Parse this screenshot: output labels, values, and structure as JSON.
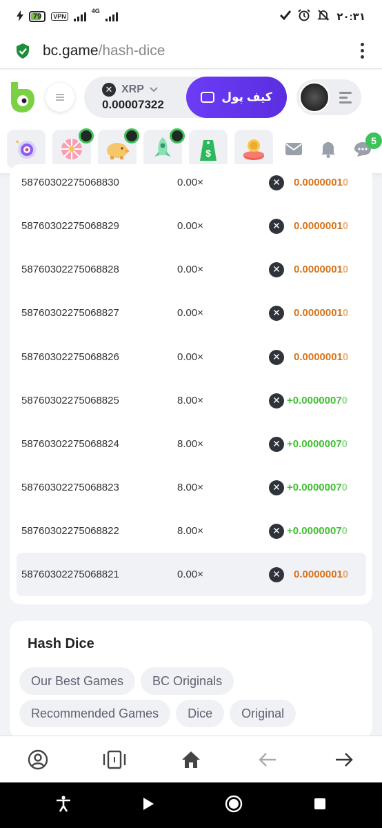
{
  "status_bar": {
    "battery": "79",
    "vpn": "VPN",
    "network": "4G",
    "time": "۲۰:۳۱"
  },
  "browser": {
    "domain": "bc.game",
    "path": "/hash-dice"
  },
  "header": {
    "currency": "XRP",
    "balance": "0.00007322",
    "wallet_button": "کیف پول"
  },
  "notifications": {
    "chat_badge": "5"
  },
  "bets": [
    {
      "id": "58760302275068830",
      "multiplier": "0.00×",
      "amount": "0.0000001",
      "last": "0",
      "result": "loss"
    },
    {
      "id": "58760302275068829",
      "multiplier": "0.00×",
      "amount": "0.0000001",
      "last": "0",
      "result": "loss"
    },
    {
      "id": "58760302275068828",
      "multiplier": "0.00×",
      "amount": "0.0000001",
      "last": "0",
      "result": "loss"
    },
    {
      "id": "58760302275068827",
      "multiplier": "0.00×",
      "amount": "0.0000001",
      "last": "0",
      "result": "loss"
    },
    {
      "id": "58760302275068826",
      "multiplier": "0.00×",
      "amount": "0.0000001",
      "last": "0",
      "result": "loss"
    },
    {
      "id": "58760302275068825",
      "multiplier": "8.00×",
      "amount": "+0.0000007",
      "last": "0",
      "result": "win"
    },
    {
      "id": "58760302275068824",
      "multiplier": "8.00×",
      "amount": "+0.0000007",
      "last": "0",
      "result": "win"
    },
    {
      "id": "58760302275068823",
      "multiplier": "8.00×",
      "amount": "+0.0000007",
      "last": "0",
      "result": "win"
    },
    {
      "id": "58760302275068822",
      "multiplier": "8.00×",
      "amount": "+0.0000007",
      "last": "0",
      "result": "win"
    },
    {
      "id": "58760302275068821",
      "multiplier": "0.00×",
      "amount": "0.0000001",
      "last": "0",
      "result": "loss"
    }
  ],
  "game": {
    "title": "Hash Dice",
    "tags": [
      "Our Best Games",
      "BC Originals",
      "Recommended Games",
      "Dice",
      "Original"
    ]
  },
  "colors": {
    "accent": "#6c3cf5",
    "win": "#3fbf32",
    "loss": "#d7741a",
    "badge": "#3cc35a"
  }
}
